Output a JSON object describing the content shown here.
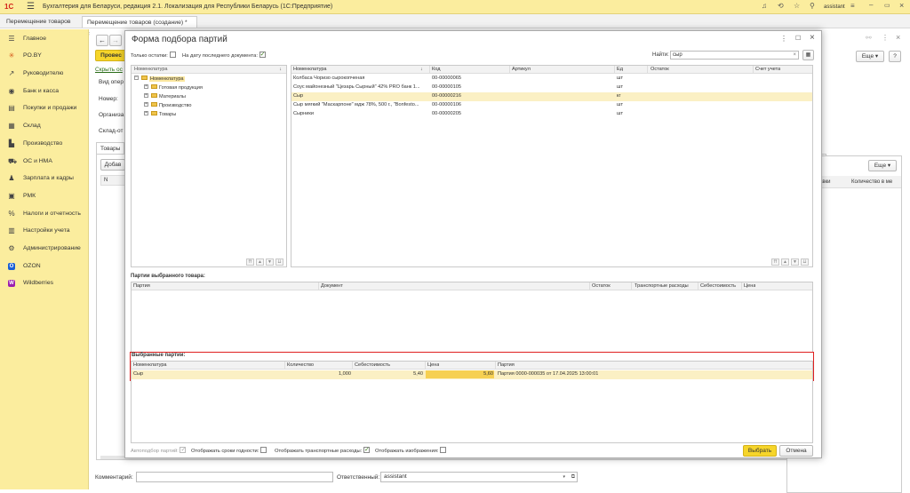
{
  "app": {
    "title": "Бухгалтерия для Беларуси, редакция 2.1. Локализация для Республики Беларусь   (1С:Предприятие)",
    "user": "assistant"
  },
  "tabs": [
    {
      "label": "Перемещение товаров",
      "close": "×"
    },
    {
      "label": "Перемещение товаров (создание) *",
      "close": "×"
    }
  ],
  "sidebar": {
    "items": [
      {
        "label": "Главное",
        "icon": "☰"
      },
      {
        "label": "PO.BY",
        "icon": "✳"
      },
      {
        "label": "Руководителю",
        "icon": "↗"
      },
      {
        "label": "Банк и касса",
        "icon": "◉"
      },
      {
        "label": "Покупки и продажи",
        "icon": "▤"
      },
      {
        "label": "Склад",
        "icon": "▦"
      },
      {
        "label": "Производство",
        "icon": "▙"
      },
      {
        "label": "ОС и НМА",
        "icon": "⛟"
      },
      {
        "label": "Зарплата и кадры",
        "icon": "♟"
      },
      {
        "label": "РМК",
        "icon": "▣"
      },
      {
        "label": "Налоги и отчетность",
        "icon": "%"
      },
      {
        "label": "Настройки учета",
        "icon": "▥"
      },
      {
        "label": "Администрирование",
        "icon": "⚙"
      },
      {
        "label": "OZON",
        "icon": "O"
      },
      {
        "label": "Wildberries",
        "icon": "W"
      }
    ]
  },
  "doc": {
    "post_button": "Провес",
    "link": "Скрыть ос",
    "field_labels": [
      "Вид опер",
      "Номер:",
      "Организа",
      "Склад-от"
    ],
    "tab_goods": "Товары",
    "add_button": "Добав",
    "col_n": "N",
    "right_col1": "авки",
    "right_col2": "Количество в ме",
    "more_button": "Еще",
    "more_button2": "Еще",
    "help_button": "?",
    "comment_label": "Комментарий:",
    "responsible_label": "Ответственный:",
    "responsible_value": "assistant"
  },
  "modal": {
    "title": "Форма подбора партий",
    "only_remains": "Только остатки:",
    "last_doc_date": "На дату последнего документа:",
    "find_label": "Найти:",
    "find_value": "сыр",
    "tree": {
      "header": "Номенклатура",
      "root": "Номенклатура",
      "children": [
        "Готовая продукция",
        "Материалы",
        "Производство",
        "Товары"
      ]
    },
    "items": {
      "columns": [
        "Номенклатура",
        "Код",
        "Артикул",
        "Ед",
        "Остаток",
        "Счет учета"
      ],
      "rows": [
        {
          "name": "Колбаса Чоризо сырокопченая",
          "code": "00-00000065",
          "art": "",
          "unit": "шт"
        },
        {
          "name": "Соус майонезный \"Цезарь Сырный\" 42% PRO банк 1...",
          "code": "00-00000105",
          "art": "",
          "unit": "шт"
        },
        {
          "name": "Сыр",
          "code": "00-00000216",
          "art": "",
          "unit": "кг"
        },
        {
          "name": "Сыр мягкий \"Маскарпоне\" мдж 78%, 500 г., \"Bonfesto...",
          "code": "00-00000106",
          "art": "",
          "unit": "шт"
        },
        {
          "name": "Сырники",
          "code": "00-00000205",
          "art": "",
          "unit": "шт"
        }
      ],
      "selected_index": 2
    },
    "batches": {
      "title": "Партии выбранного товара:",
      "columns": [
        "Партия",
        "Документ",
        "Остаток",
        "Транспортные расходы",
        "Себестоимость",
        "Цена"
      ]
    },
    "selected": {
      "title": "Выбранные партии:",
      "columns": [
        "Номенклатура",
        "Количество",
        "Себестоимость",
        "Цена",
        "Партия"
      ],
      "rows": [
        {
          "name": "Сыр",
          "qty": "1,000",
          "cost": "5,40",
          "price": "5,60",
          "batch": "Партия 0000-000035 от 17.04.2025 13:00:01"
        }
      ]
    },
    "footer": {
      "auto": "Автоподбор партий:",
      "show_expiry": "Отображать сроки годности:",
      "show_transport": "Отображать транспортные расходы:",
      "show_images": "Отображать изображения:",
      "select_button": "Выбрать",
      "cancel_button": "Отмена"
    }
  },
  "colors": {
    "accent_yellow": "#fbed9e",
    "button_yellow": "#f6d52a",
    "selected_row": "#fbf0c4",
    "highlight_red": "#e02020"
  }
}
